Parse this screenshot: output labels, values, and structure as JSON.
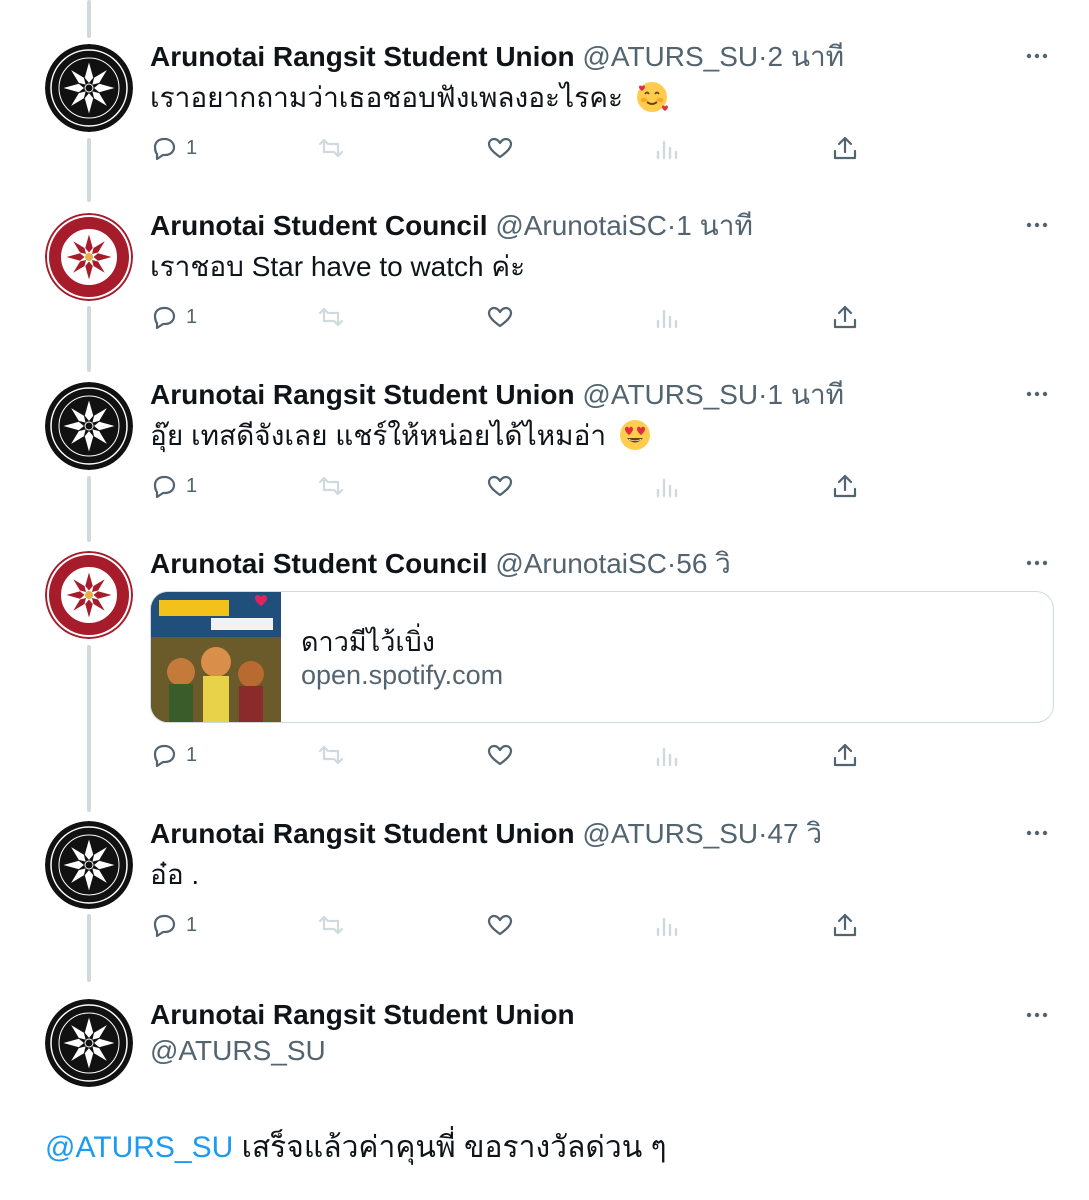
{
  "tweets": [
    {
      "name": "Arunotai Rangsit Student Union",
      "handle": "@ATURS_SU",
      "time": "2 นาที",
      "text": "เราอยากถามว่าเธอชอบฟังเพลงอะไรคะ",
      "emoji": "smiling-face-with-hearts",
      "reply_count": "1",
      "avatar": "rangsit-union-logo"
    },
    {
      "name": "Arunotai Student Council",
      "handle": "@ArunotaiSC",
      "time": "1 นาที",
      "text": "เราชอบ Star have to watch ค่ะ",
      "reply_count": "1",
      "avatar": "student-council-logo"
    },
    {
      "name": "Arunotai Rangsit Student Union",
      "handle": "@ATURS_SU",
      "time": "1 นาที",
      "text": "อุ๊ย เทสดีจังเลย แชร์ให้หน่อยได้ไหมอ่า",
      "emoji": "heart-eyes",
      "reply_count": "1",
      "avatar": "rangsit-union-logo"
    },
    {
      "name": "Arunotai Student Council",
      "handle": "@ArunotaiSC",
      "time": "56 วิ",
      "card": {
        "title": "ดาวมีไว้เบิ่ง",
        "domain": "open.spotify.com"
      },
      "reply_count": "1",
      "avatar": "student-council-logo"
    },
    {
      "name": "Arunotai Rangsit Student Union",
      "handle": "@ATURS_SU",
      "time": "47 วิ",
      "text": "อ๋อ .",
      "reply_count": "1",
      "avatar": "rangsit-union-logo"
    }
  ],
  "main": {
    "name": "Arunotai Rangsit Student Union",
    "handle": "@ATURS_SU",
    "mention": "@ATURS_SU",
    "text": " เสร็จแล้วค่าคุนพี่ ขอรางวัลด่วน ๆ"
  },
  "separator": "·",
  "colors": {
    "accent": "#1d9bf0",
    "muted": "#536471",
    "text": "#0f1419",
    "line": "#cfd9de"
  }
}
